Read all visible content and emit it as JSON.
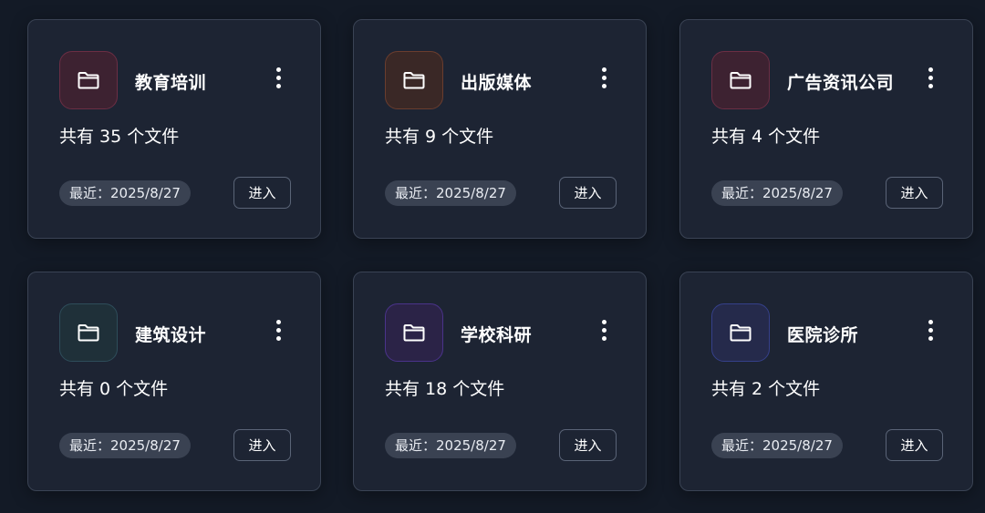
{
  "colors": {
    "page_background": "#131a26",
    "card_background": "#1d2433",
    "card_border": "#3a4354",
    "pill_background": "#3a4252"
  },
  "cards": [
    {
      "title": "教育培训",
      "file_count": "共有 35 个文件",
      "date": "最近：2025/8/27",
      "enter_label": "进入",
      "icon": "folder-icon",
      "icon_bg": "#3d2231",
      "icon_border": "#6b2e44"
    },
    {
      "title": "出版媒体",
      "file_count": "共有 9 个文件",
      "date": "最近：2025/8/27",
      "enter_label": "进入",
      "icon": "folder-icon",
      "icon_bg": "#3a2826",
      "icon_border": "#6a3d2e"
    },
    {
      "title": "广告资讯公司",
      "file_count": "共有 4 个文件",
      "date": "最近：2025/8/27",
      "enter_label": "进入",
      "icon": "folder-icon",
      "icon_bg": "#3d2231",
      "icon_border": "#6b2e44"
    },
    {
      "title": "建筑设计",
      "file_count": "共有 0 个文件",
      "date": "最近：2025/8/27",
      "enter_label": "进入",
      "icon": "folder-icon",
      "icon_bg": "#1f3039",
      "icon_border": "#2e4d5a"
    },
    {
      "title": "学校科研",
      "file_count": "共有 18 个文件",
      "date": "最近：2025/8/27",
      "enter_label": "进入",
      "icon": "folder-icon",
      "icon_bg": "#2b2347",
      "icon_border": "#4a338a"
    },
    {
      "title": "医院诊所",
      "file_count": "共有 2 个文件",
      "date": "最近：2025/8/27",
      "enter_label": "进入",
      "icon": "folder-icon",
      "icon_bg": "#252a4b",
      "icon_border": "#35408a"
    }
  ]
}
